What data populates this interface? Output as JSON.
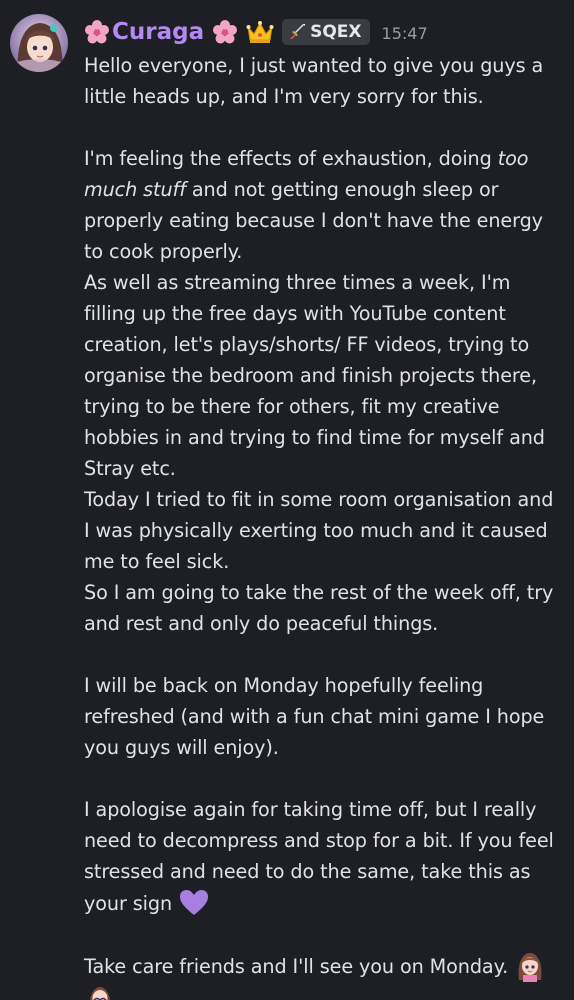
{
  "author": {
    "name": "Curaga",
    "tag": "SQEX",
    "timestamp": "15:47",
    "avatar_icon": "anime-girl-avatar-icon",
    "name_color": "#b389f5",
    "prefix_icon": "cherry-blossom-icon",
    "suffix_icon": "cherry-blossom-icon",
    "badge_icon": "crown-icon",
    "tag_icon": "sword-icon"
  },
  "message": {
    "p1": "Hello everyone, I just wanted to give you guys a little heads up, and I'm very sorry for this.",
    "p2_before": "I'm feeling the effects of exhaustion, doing ",
    "p2_em": "too much stuff",
    "p2_after": " and not getting enough sleep or properly eating because I don't have the energy to cook properly.",
    "p3": "As well as streaming three times a week, I'm filling up the free days with YouTube content creation, let's plays/shorts/ FF videos, trying to organise the bedroom and finish projects there, trying to be there for others, fit my creative hobbies in and trying to find time for myself and Stray etc.",
    "p4": "Today I tried to fit in some room organisation and I was physically exerting too much and it caused me to feel sick.",
    "p5": "So I am going to take the rest of the week off, try and rest and only do peaceful things.",
    "p6": "I will be back on Monday hopefully feeling refreshed (and with a fun chat mini game I hope you guys will enjoy).",
    "p7": "I apologise again for taking time off, but I really need to decompress and stop for a bit. If you feel stressed and need to do the same, take this as your sign",
    "p7_emoji": "purple-heart-icon",
    "p8": "Take care friends and I'll see you on Monday.",
    "p8_emojis": [
      "girl-emote-icon",
      "hug-emote-icon"
    ]
  }
}
